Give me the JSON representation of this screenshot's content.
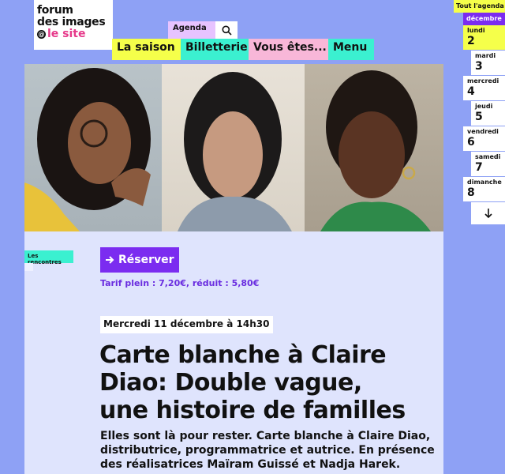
{
  "logo": {
    "line1": "forum",
    "line2": "des images",
    "line3": "le site"
  },
  "topbar": {
    "agenda_label": "Agenda"
  },
  "nav": {
    "items": [
      "La saison",
      "Billetterie",
      "Vous êtes...",
      "Menu"
    ]
  },
  "event": {
    "category": "Les rencontres",
    "reserve_label": "Réserver",
    "price": "Tarif plein : 7,20€, réduit : 5,80€",
    "datetime": "Mercredi 11 décembre à 14h30",
    "title": "Carte blanche à Claire Diao: Double vague, une histoire de familles",
    "description": "Elles sont là pour rester. Carte blanche à Claire Diao, distributrice, programmatrice et autrice. En présence des réalisatrices Maïram Guissé et Nadja Harek."
  },
  "agenda_sidebar": {
    "all_label": "Tout l'agenda",
    "month": "décembre",
    "days": [
      {
        "name": "lundi",
        "num": "2"
      },
      {
        "name": "mardi",
        "num": "3"
      },
      {
        "name": "mercredi",
        "num": "4"
      },
      {
        "name": "jeudi",
        "num": "5"
      },
      {
        "name": "vendredi",
        "num": "6"
      },
      {
        "name": "samedi",
        "num": "7"
      },
      {
        "name": "dimanche",
        "num": "8"
      }
    ]
  },
  "colors": {
    "background": "#8ea1f5",
    "accent_purple": "#7b2cf0",
    "yellow": "#f5ff4a",
    "turquoise": "#3bf0d0",
    "pink": "#f8b7d8",
    "logo_pink": "#e6398a"
  },
  "icons": [
    "search-icon",
    "arrow-right-icon",
    "arrow-down-icon"
  ]
}
